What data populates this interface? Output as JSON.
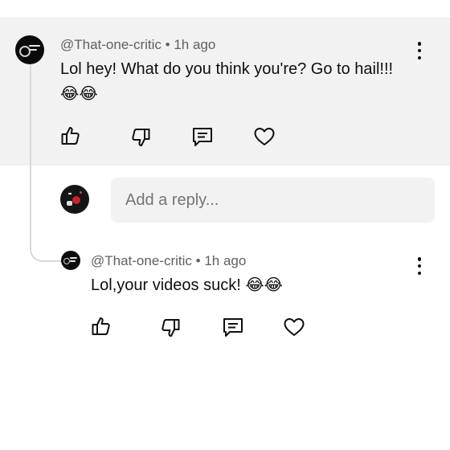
{
  "comment": {
    "author": "@That-one-critic",
    "separator": "•",
    "time": "1h ago",
    "text_line1": "Lol hey! What do you think you're? Go to hail!!!",
    "text_line2": "😂😂"
  },
  "reply_input": {
    "placeholder": "Add a reply..."
  },
  "reply": {
    "author": "@That-one-critic",
    "separator": "•",
    "time": "1h ago",
    "text": "Lol,your videos suck! 😂😂"
  },
  "icons": [
    "like-icon",
    "dislike-icon",
    "reply-icon",
    "heart-icon",
    "more-options-icon"
  ],
  "colors": {
    "highlight_bg": "#f2f2f2",
    "secondary_text": "#606060",
    "thread_line": "#d9d9d9"
  }
}
